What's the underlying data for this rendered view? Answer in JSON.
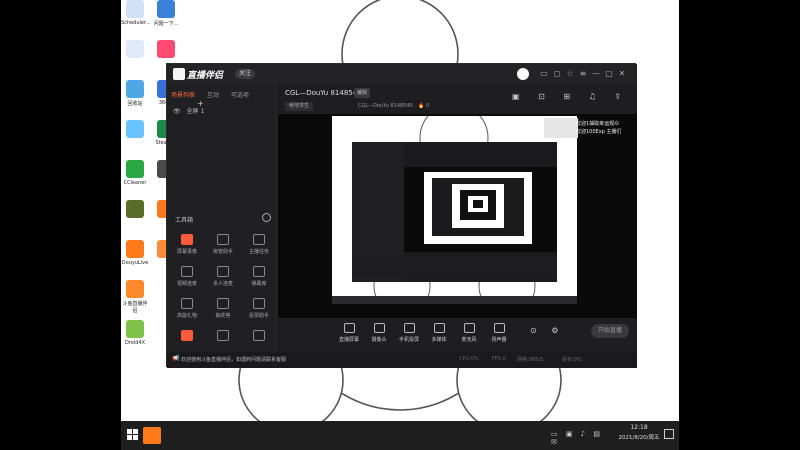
{
  "desktop": {
    "icons_left": [
      {
        "label": "Scheduler...",
        "color": "#cfe1f7"
      },
      {
        "label": "",
        "color": "#dfe9f7"
      },
      {
        "label": "回收站",
        "color": "#4fa7e6"
      },
      {
        "label": "",
        "color": "#6ac4ff"
      },
      {
        "label": "CCleaner",
        "color": "#2aa844"
      },
      {
        "label": "",
        "color": "#5a6b2a"
      },
      {
        "label": "DouyuLive",
        "color": "#ff7a1a"
      },
      {
        "label": "斗鱼直播伴侣",
        "color": "#ff8a2a"
      },
      {
        "label": "Droid4X",
        "color": "#7fc24a"
      }
    ],
    "icons_right": [
      {
        "label": "问题一下...",
        "color": "#3a7fd8"
      },
      {
        "label": "",
        "color": "#ff4a72"
      },
      {
        "label": "360...",
        "color": "#3a6ed8"
      },
      {
        "label": "Steam...",
        "color": "#1e8a4a"
      },
      {
        "label": "",
        "color": "#4a4a4a"
      },
      {
        "label": "",
        "color": "#ff7a1a"
      },
      {
        "label": "",
        "color": "#ff8a3a"
      }
    ]
  },
  "app": {
    "logo_text": "直播伴侣",
    "badge": "关注",
    "window_buttons": [
      "▭",
      "◻",
      "☆",
      "≡",
      "—",
      "□",
      "✕"
    ],
    "sidebar": {
      "tabs": [
        "场景列表",
        "互动",
        "可选项",
        "+"
      ],
      "scene_item": "全屏 1",
      "toolbox_title": "工具箱",
      "tools": [
        {
          "label": "屏幕录像",
          "hot": true
        },
        {
          "label": "房管助手",
          "hot": false
        },
        {
          "label": "主播任务",
          "hot": false
        },
        {
          "label": "视频连麦",
          "hot": false
        },
        {
          "label": "多人连麦",
          "hot": false
        },
        {
          "label": "弹幕库",
          "hot": false
        },
        {
          "label": "高能礼物",
          "hot": false
        },
        {
          "label": "抽奖券",
          "hot": false
        },
        {
          "label": "投票助手",
          "hot": false
        },
        {
          "label": "",
          "hot": true
        },
        {
          "label": "",
          "hot": false
        },
        {
          "label": "",
          "hot": false
        }
      ]
    },
    "topbar": {
      "stream_title": "CGL—DouYu 8148540",
      "edit_label": "编辑",
      "category": "绝地求生",
      "subtitle": "CGL—DouYu  8148540",
      "viewers": "0"
    },
    "bottom_tools": [
      {
        "label": "直播屏幕"
      },
      {
        "label": "摄像头"
      },
      {
        "label": "手机投屏"
      },
      {
        "label": "多媒体"
      },
      {
        "label": "麦克风"
      },
      {
        "label": "扬声器"
      }
    ],
    "go_live": "开始直播",
    "status_notice": "欢迎使用斗鱼直播伴侣，如遇到问题请联系客服",
    "stats": [
      "CPU:0%",
      "FPS:0",
      "网络:0KB/S",
      "丢帧:0%"
    ],
    "overlay_lines": [
      "欢迎1抽取幸运观众",
      "欢迎100Exp 主播们"
    ]
  },
  "taskbar": {
    "time": "12:18",
    "date": "2021/8/20/周五"
  }
}
